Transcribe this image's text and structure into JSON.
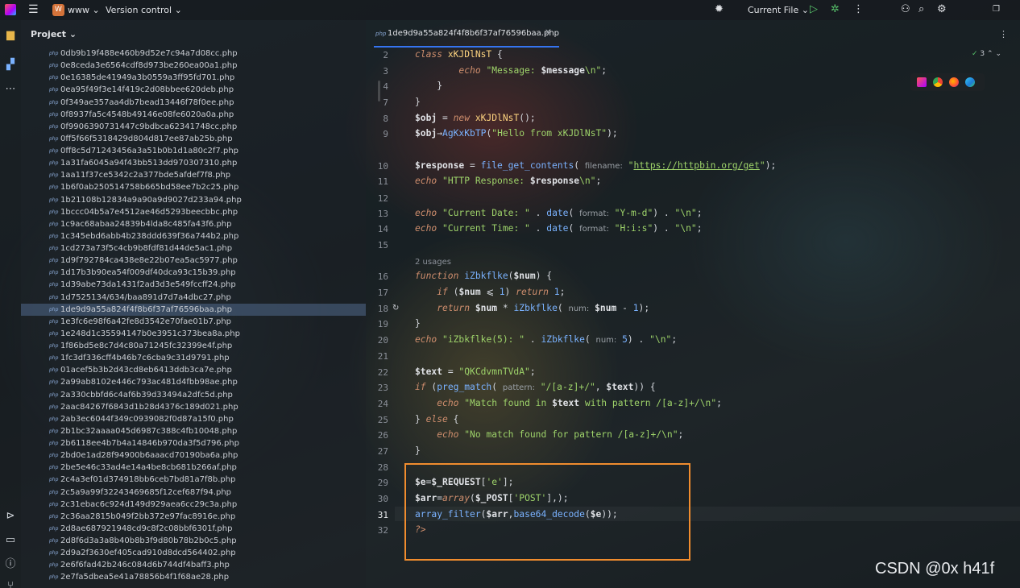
{
  "topbar": {
    "project_badge": "W",
    "project_name": "www",
    "vcs": "Version control",
    "run_config": "Current File"
  },
  "project_panel": {
    "title": "Project",
    "files": [
      "0db9b19f488e460b9d52e7c94a7d08cc.php",
      "0e8ceda3e6564cdf8d973be260ea00a1.php",
      "0e16385de41949a3b0559a3ff95fd701.php",
      "0ea95f49f3e14f419c2d08bbee620deb.php",
      "0f349ae357aa4db7bead13446f78f0ee.php",
      "0f8937fa5c4548b49146e08fe6020a0a.php",
      "0f9906390731447c9bdbca62341748cc.php",
      "0ff5f66f5318429d804d817ee87ab25b.php",
      "0ff8c5d71243456a3a51b0b1d1a80c2f7.php",
      "1a31fa6045a94f43bb513dd970307310.php",
      "1aa11f37ce5342c2a377bde5afdef7f8.php",
      "1b6f0ab250514758b665bd58ee7b2c25.php",
      "1b21108b12834a9a90a9d9027d233a94.php",
      "1bccc04b5a7e4512ae46d5293beecbbc.php",
      "1c9ac68abaa24839b4lda8c485fa43f6.php",
      "1c345ebd6abb4b238ddd639f36a744b2.php",
      "1cd273a73f5c4cb9b8fdf81d44de5ac1.php",
      "1d9f792784ca438e8e22b07ea5ac5977.php",
      "1d17b3b90ea54f009df40dca93c15b39.php",
      "1d39abe73da1431f2ad3d3e549fccff24.php",
      "1d7525134/634/baa891d7d7a4dbc27.php",
      "1de9d9a55a824f4f8b6f37af76596baa.php",
      "1e3fc6e98f6a42fe8d3542e70fae01b7.php",
      "1e248d1c35594147b0e3951c373bea8a.php",
      "1f86bd5e8c7d4c80a71245fc32399e4f.php",
      "1fc3df336cff4b46b7c6cba9c31d9791.php",
      "01acef5b3b2d43cd8eb6413ddb3ca7e.php",
      "2a99ab8102e446c793ac481d4fbb98ae.php",
      "2a330cbbfd6c4af6b39d33494a2dfc5d.php",
      "2aac84267f6843d1b28d4376c189d021.php",
      "2ab3ec6044f349c0939082f0d87a15f0.php",
      "2b1bc32aaaa045d6987c388c4fb10048.php",
      "2b6118ee4b7b4a14846b970da3f5d796.php",
      "2bd0e1ad28f94900b6aaacd70190ba6a.php",
      "2be5e46c33ad4e14a4be8cb681b266af.php",
      "2c4a3ef01d374918bb6ceb7bd81a7f8b.php",
      "2c5a9a99f32243469685f12cef687f94.php",
      "2c31ebac6c924d149d929aea6cc29c3a.php",
      "2c36aa2815b049f2bb372e97fac8916e.php",
      "2d8ae687921948cd9c8f2c08bbf6301f.php",
      "2d8f6d3a3a8b40b8b3f9d80b78b2b0c5.php",
      "2d9a2f3630ef405cad910d8dcd564402.php",
      "2e6f6fad42b246c084d6b744df4baff3.php",
      "2e7fa5dbea5e41a78856b4f1f68ae28.php"
    ],
    "selected_index": 21
  },
  "editor": {
    "tab_label": "1de9d9a55a824f4f8b6f37af76596baa.php",
    "inspection_count": "3",
    "line_numbers": [
      "2",
      "3",
      "4",
      "7",
      "8",
      "9",
      "10",
      "11",
      "12",
      "13",
      "14",
      "15",
      "",
      "16",
      "17",
      "18",
      "19",
      "20",
      "21",
      "22",
      "23",
      "24",
      "25",
      "26",
      "27",
      "28",
      "29",
      "30",
      "31",
      "32"
    ],
    "usages_text": "2 usages"
  },
  "watermark": "CSDN @0x h41f"
}
